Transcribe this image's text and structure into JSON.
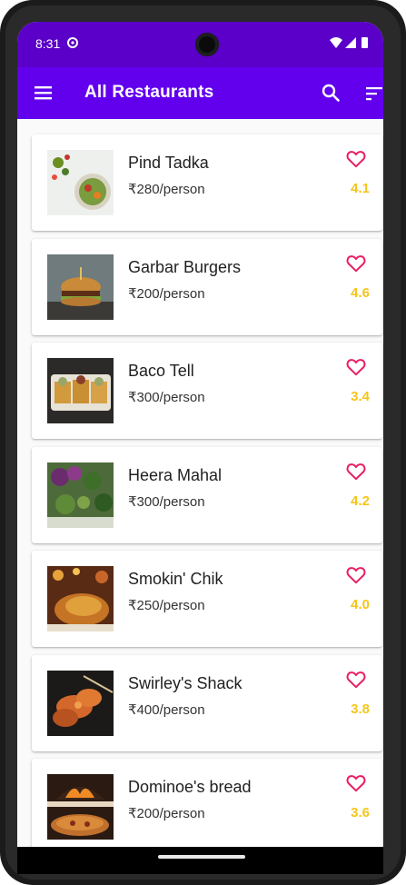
{
  "status_bar": {
    "time": "8:31"
  },
  "app_bar": {
    "title": "All Restaurants",
    "color": "#6200ee",
    "status_color": "#5a00c8"
  },
  "icons": {
    "menu": "menu-icon",
    "search": "search-icon",
    "sort": "sort-icon",
    "favorite": "heart-outline-icon"
  },
  "accent": {
    "heart": "#e91e63",
    "rating": "#f5c518"
  },
  "restaurants": [
    {
      "name": "Pind Tadka",
      "price": "₹280/person",
      "rating": "4.1",
      "photo": "salad"
    },
    {
      "name": "Garbar Burgers",
      "price": "₹200/person",
      "rating": "4.6",
      "photo": "burger"
    },
    {
      "name": "Baco Tell",
      "price": "₹300/person",
      "rating": "3.4",
      "photo": "tacos"
    },
    {
      "name": "Heera Mahal",
      "price": "₹300/person",
      "rating": "4.2",
      "photo": "vegetables"
    },
    {
      "name": "Smokin' Chik",
      "price": "₹250/person",
      "rating": "4.0",
      "photo": "roast-chicken"
    },
    {
      "name": "Swirley's Shack",
      "price": "₹400/person",
      "rating": "3.8",
      "photo": "shrimp-skewers"
    },
    {
      "name": "Dominoe's bread",
      "price": "₹200/person",
      "rating": "3.6",
      "photo": "pizza-oven"
    }
  ]
}
